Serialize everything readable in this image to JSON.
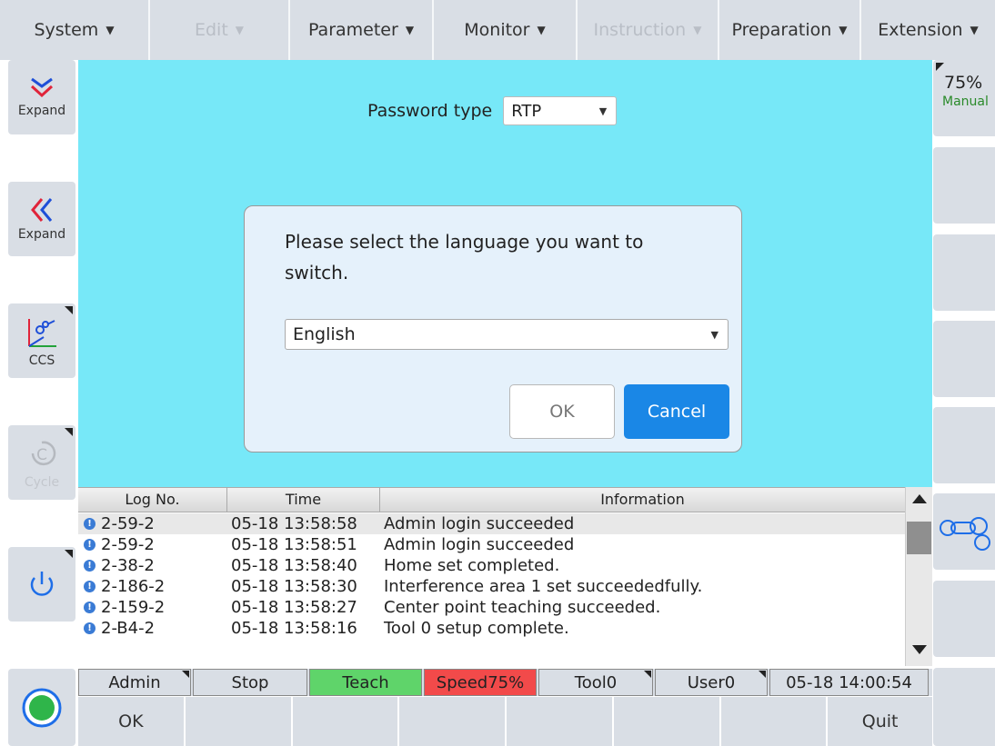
{
  "menu": [
    {
      "label": "System",
      "disabled": false
    },
    {
      "label": "Edit",
      "disabled": true
    },
    {
      "label": "Parameter",
      "disabled": false
    },
    {
      "label": "Monitor",
      "disabled": false
    },
    {
      "label": "Instruction",
      "disabled": true
    },
    {
      "label": "Preparation",
      "disabled": false
    },
    {
      "label": "Extension",
      "disabled": false
    }
  ],
  "left": {
    "expand_down_label": "Expand",
    "expand_left_label": "Expand",
    "ccs_label": "CCS",
    "cycle_label": "Cycle"
  },
  "right": {
    "speed": "75%",
    "mode": "Manual"
  },
  "main": {
    "password_type_label": "Password type",
    "password_type_value": "RTP"
  },
  "dialog": {
    "message": "Please select the language you want to switch.",
    "language_value": "English",
    "ok_label": "OK",
    "cancel_label": "Cancel"
  },
  "log": {
    "headers": [
      "Log No.",
      "Time",
      "Information"
    ],
    "rows": [
      {
        "no": "2-59-2",
        "time": "05-18 13:58:58",
        "info": "Admin  login succeeded"
      },
      {
        "no": "2-59-2",
        "time": "05-18 13:58:51",
        "info": "Admin  login succeeded"
      },
      {
        "no": "2-38-2",
        "time": "05-18 13:58:40",
        "info": "Home set completed."
      },
      {
        "no": "2-186-2",
        "time": "05-18 13:58:30",
        "info": "Interference area 1 set succeededfully."
      },
      {
        "no": "2-159-2",
        "time": "05-18 13:58:27",
        "info": "Center point teaching succeeded."
      },
      {
        "no": "2-B4-2",
        "time": "05-18 13:58:16",
        "info": "Tool 0 setup complete."
      }
    ]
  },
  "status": {
    "user": "Admin",
    "state": "Stop",
    "mode": "Teach",
    "speed": "Speed75%",
    "tool": "Tool0",
    "user_frame": "User0",
    "datetime": "05-18 14:00:54",
    "colors": {
      "teach": "#5fd46a",
      "speed": "#f24a4a"
    }
  },
  "bottom": {
    "ok_label": "OK",
    "quit_label": "Quit"
  }
}
